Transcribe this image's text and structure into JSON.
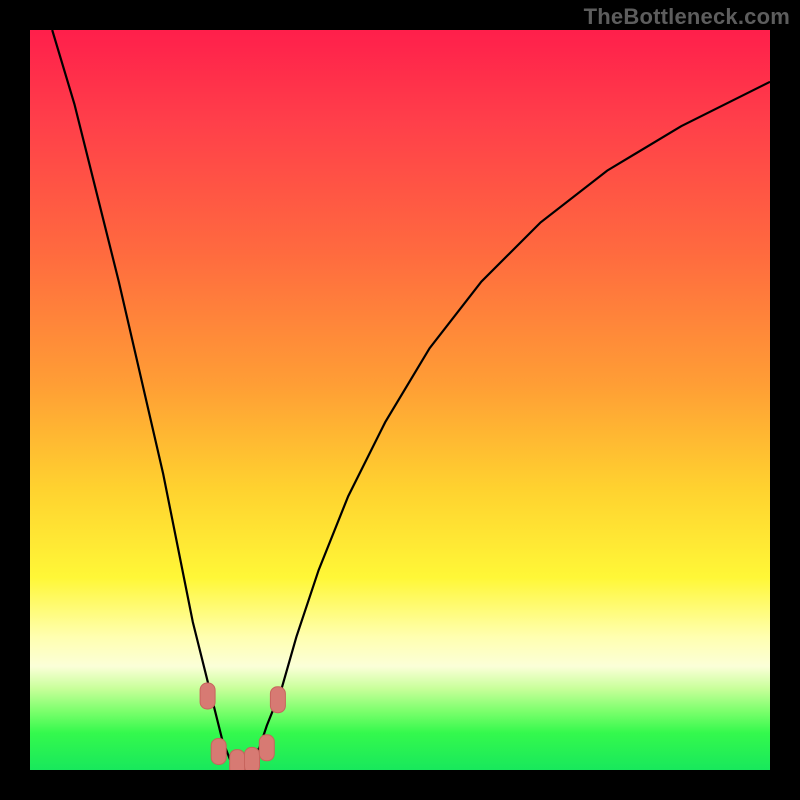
{
  "watermark": "TheBottleneck.com",
  "colors": {
    "background": "#000000",
    "curve": "#000000",
    "marker_fill": "#d77a73",
    "marker_stroke": "#c7645d"
  },
  "chart_data": {
    "type": "line",
    "title": "",
    "xlabel": "",
    "ylabel": "",
    "xlim": [
      0,
      100
    ],
    "ylim": [
      0,
      100
    ],
    "note": "V-shaped bottleneck curve on rainbow heat gradient; y represents bottleneck severity (high=red, low=green). Values estimated from pixel positions; no numeric axes are shown.",
    "series": [
      {
        "name": "bottleneck-curve",
        "x": [
          3,
          6,
          9,
          12,
          15,
          18,
          20,
          22,
          24,
          25,
          26,
          27,
          28,
          29,
          30,
          31,
          32,
          34,
          36,
          39,
          43,
          48,
          54,
          61,
          69,
          78,
          88,
          100
        ],
        "y": [
          100,
          90,
          78,
          66,
          53,
          40,
          30,
          20,
          12,
          8,
          4,
          1.5,
          0.5,
          0.5,
          1.5,
          3,
          6,
          11,
          18,
          27,
          37,
          47,
          57,
          66,
          74,
          81,
          87,
          93
        ]
      }
    ],
    "markers": [
      {
        "x": 24.0,
        "y": 10.0
      },
      {
        "x": 25.5,
        "y": 2.5
      },
      {
        "x": 28.0,
        "y": 1.0
      },
      {
        "x": 30.0,
        "y": 1.3
      },
      {
        "x": 32.0,
        "y": 3.0
      },
      {
        "x": 33.5,
        "y": 9.5
      }
    ],
    "gradient_stops": [
      {
        "pos": 0,
        "color": "#ff1f4b"
      },
      {
        "pos": 30,
        "color": "#ff6a3f"
      },
      {
        "pos": 62,
        "color": "#ffd22f"
      },
      {
        "pos": 82,
        "color": "#ffffb0"
      },
      {
        "pos": 92,
        "color": "#7dff6d"
      },
      {
        "pos": 100,
        "color": "#18e85c"
      }
    ]
  }
}
